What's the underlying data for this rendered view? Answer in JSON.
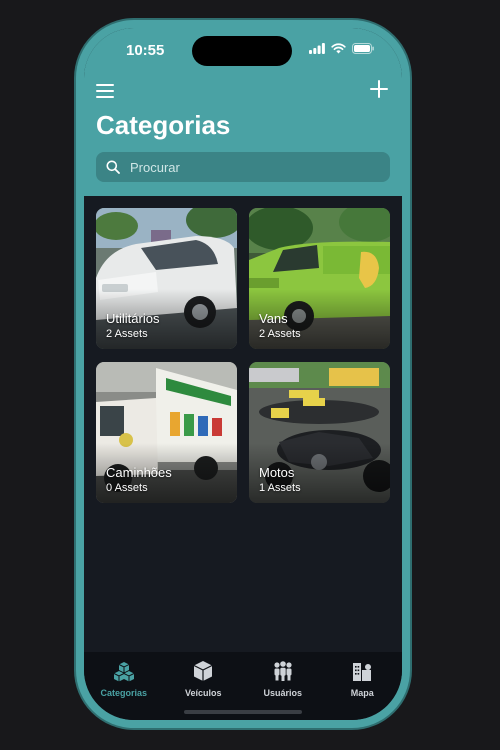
{
  "status_bar": {
    "time": "10:55"
  },
  "header": {
    "title": "Categorias"
  },
  "search": {
    "placeholder": "Procurar"
  },
  "categories": [
    {
      "name": "Utilitários",
      "count": "2 Assets",
      "image": "white-car-photo"
    },
    {
      "name": "Vans",
      "count": "2 Assets",
      "image": "green-van-photo"
    },
    {
      "name": "Caminhões",
      "count": "0 Assets",
      "image": "truck-photo"
    },
    {
      "name": "Motos",
      "count": "1 Assets",
      "image": "motorcycles-photo"
    }
  ],
  "tabs": [
    {
      "label": "Categorias",
      "icon": "cubes-icon",
      "active": true
    },
    {
      "label": "Veículos",
      "icon": "box-icon",
      "active": false
    },
    {
      "label": "Usuários",
      "icon": "users-icon",
      "active": false
    },
    {
      "label": "Mapa",
      "icon": "city-icon",
      "active": false
    }
  ],
  "colors": {
    "accent": "#4aa2a4",
    "background": "#161a21",
    "tab_bar": "#0d1015",
    "page_background": "#18181b"
  }
}
